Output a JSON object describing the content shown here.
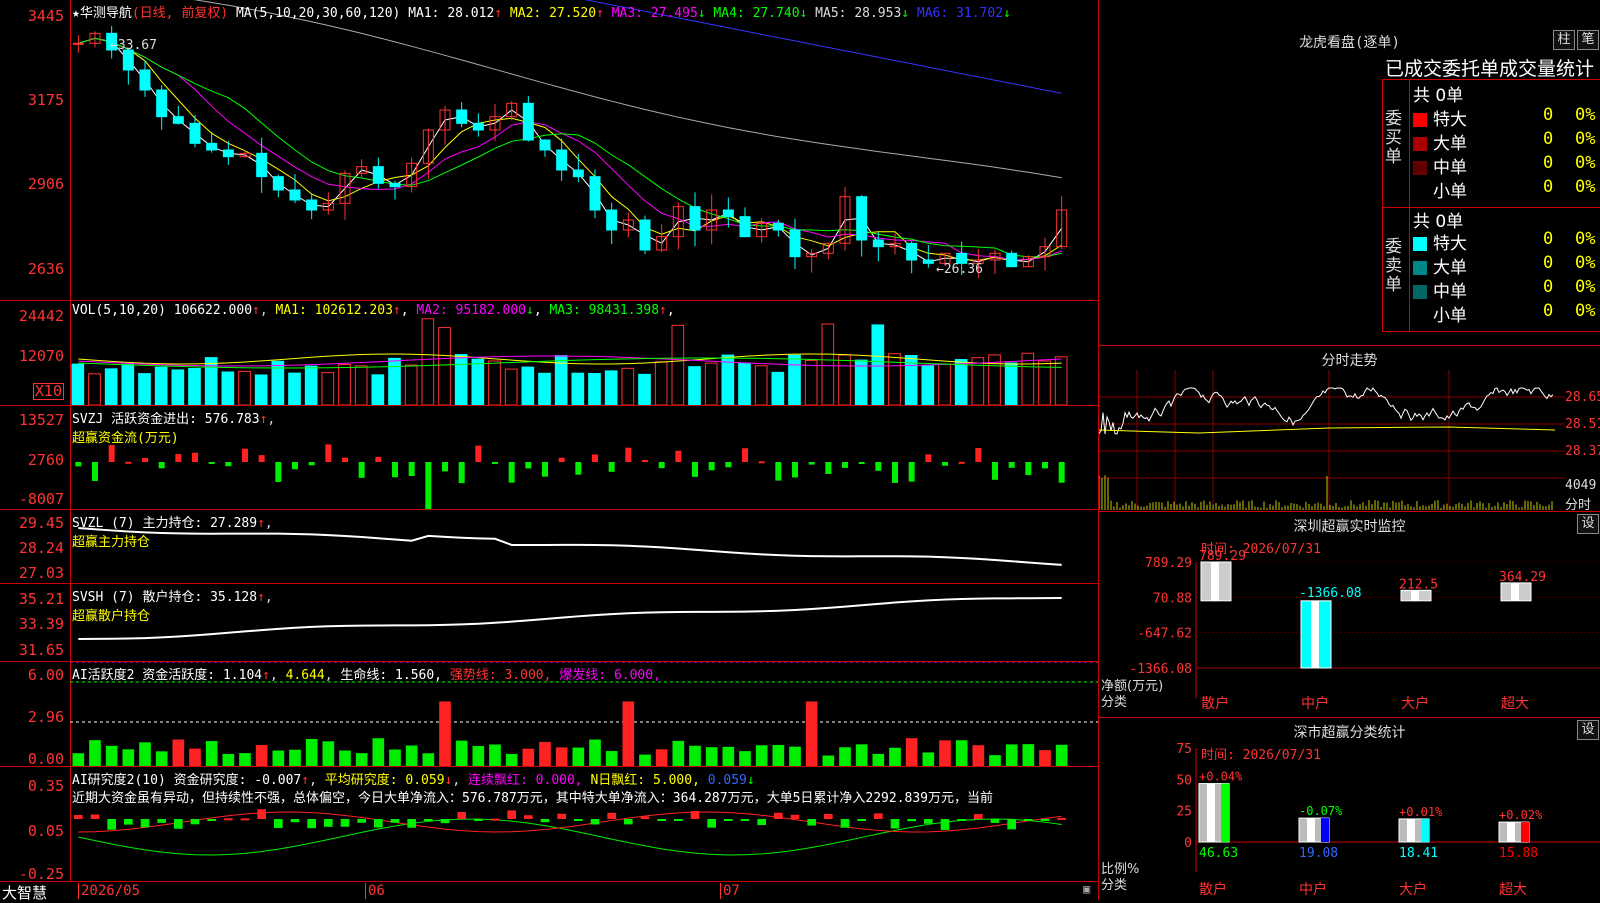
{
  "stock": {
    "name": "华测导航",
    "period": "(日线, 前复权)"
  },
  "kline": {
    "header_ma": "MA(5,10,20,30,60,120)",
    "ma_values": [
      {
        "label": "MA1:",
        "value": "28.012",
        "arrow": "↑",
        "color": "#ffffff"
      },
      {
        "label": "MA2:",
        "value": "27.520",
        "arrow": "↑",
        "color": "#ffff00"
      },
      {
        "label": "MA3:",
        "value": "27.495",
        "arrow": "↓",
        "color": "#ff00ff"
      },
      {
        "label": "MA4:",
        "value": "27.740",
        "arrow": "↓",
        "color": "#00ff00"
      },
      {
        "label": "MA5:",
        "value": "28.953",
        "arrow": "↓",
        "color": "#dddddd"
      },
      {
        "label": "MA6:",
        "value": "31.702",
        "arrow": "↓",
        "color": "#3333ff"
      }
    ],
    "y_labels": [
      "3445",
      "3175",
      "2906",
      "2636"
    ],
    "high_label": "←33.67",
    "low_label": "←26.36"
  },
  "vol": {
    "label": "VOL(5,10,20)",
    "value": "106622.000",
    "arrow": "↑",
    "ma": [
      {
        "label": "MA1:",
        "value": "102612.203",
        "arrow": "↑",
        "color": "#ffff00"
      },
      {
        "label": "MA2:",
        "value": "95182.000",
        "arrow": "↓",
        "color": "#ff00ff"
      },
      {
        "label": "MA3:",
        "value": "98431.398",
        "arrow": "↑",
        "color": "#00ff00"
      }
    ],
    "y_labels": [
      "24442",
      "12070"
    ],
    "unit": "X10"
  },
  "svzj": {
    "label": "SVZJ  活跃资金进出:",
    "value": "576.783",
    "arrow": "↑",
    "sub": "超赢资金流(万元)",
    "y_labels": [
      "13527",
      "2760",
      "-8007"
    ]
  },
  "svzl": {
    "label": "SVZL (7) 主力持仓:",
    "value": "27.289",
    "arrow": "↑",
    "sub": "超赢主力持仓",
    "y_labels": [
      "29.45",
      "28.24",
      "27.03"
    ]
  },
  "svsh": {
    "label": "SVSH (7) 散户持仓:",
    "value": "35.128",
    "arrow": "↑",
    "sub": "超赢散户持仓",
    "y_labels": [
      "35.21",
      "33.39",
      "31.65"
    ]
  },
  "ai1": {
    "label": "AI活跃度2 资金活跃度:",
    "value": "1.104",
    "arrow": "↑",
    "v2": "4.644",
    "life": "生命线: 1.560,",
    "strong": "强势线: 3.000,",
    "burst": "爆发线: 6.000,",
    "y_labels": [
      "6.00",
      "2.96",
      "0.00"
    ]
  },
  "ai2": {
    "label": "AI研究度2(10) 资金研究度:",
    "value": "-0.007",
    "arrow": "↑",
    "avg": "平均研究度: 0.059",
    "cont": "连续飘红: 0.000,",
    "nday": "N日飘红: 5.000,",
    "last": "0.059",
    "text": "近期大资金虽有异动，但持续性不强，总体偏空，今日大单净流入：576.787万元，其中特大单净流入：364.287万元，大单5日累计净入2292.839万元，当前",
    "y_labels": [
      "0.35",
      "0.05",
      "-0.25"
    ]
  },
  "xaxis": {
    "labels": [
      "2026/05",
      "06",
      "07"
    ],
    "brand": "大智慧"
  },
  "lhb": {
    "title": "龙虎看盘(逐单)",
    "btn1": "柱",
    "btn2": "笔",
    "subtitle": "已成交委托单成交量统计",
    "buy": {
      "side": "委买单",
      "total": "共 0单",
      "rows": [
        {
          "name": "特大",
          "val": "0",
          "pct": "0%",
          "color": "#ff0000"
        },
        {
          "name": "大单",
          "val": "0",
          "pct": "0%",
          "color": "#aa0000"
        },
        {
          "name": "中单",
          "val": "0",
          "pct": "0%",
          "color": "#660000"
        },
        {
          "name": "小单",
          "val": "0",
          "pct": "0%",
          "color": "#000000"
        }
      ]
    },
    "sell": {
      "side": "委卖单",
      "total": "共 0单",
      "rows": [
        {
          "name": "特大",
          "val": "0",
          "pct": "0%",
          "color": "#00ffff"
        },
        {
          "name": "大单",
          "val": "0",
          "pct": "0%",
          "color": "#008888"
        },
        {
          "name": "中单",
          "val": "0",
          "pct": "0%",
          "color": "#006666"
        },
        {
          "name": "小单",
          "val": "0",
          "pct": "0%",
          "color": "#000000"
        }
      ]
    }
  },
  "fs": {
    "title": "分时走势",
    "y_labels": [
      "28.65",
      "28.51",
      "28.37"
    ],
    "vol_label": "4049",
    "unit": "分时"
  },
  "sz_monitor": {
    "title": "深圳超赢实时监控",
    "btn": "设",
    "time": "时间: 2026/07/31",
    "y_labels": [
      "789.29",
      "70.88",
      "-647.62",
      "-1366.08"
    ],
    "unit_label": "净额(万元)",
    "cat_label": "分类",
    "bars": [
      {
        "cat": "散户",
        "value": 789.29,
        "label": "789.29"
      },
      {
        "cat": "中户",
        "value": -1366.08,
        "label": "-1366.08"
      },
      {
        "cat": "大户",
        "value": 212.5,
        "label": "212.5"
      },
      {
        "cat": "超大",
        "value": 364.29,
        "label": "364.29"
      }
    ]
  },
  "sz_class": {
    "title": "深市超赢分类统计",
    "btn": "设",
    "time": "时间: 2026/07/31",
    "y_labels": [
      "75",
      "50",
      "25",
      "0"
    ],
    "unit_label": "比例%",
    "cat_label": "分类",
    "bars": [
      {
        "cat": "散户",
        "value": 46.63,
        "pct": "+0.04%",
        "color": "#00ff00",
        "label": "46.63"
      },
      {
        "cat": "中户",
        "value": 19.08,
        "pct": "-0.07%",
        "color": "#0000ff",
        "label": "19.08"
      },
      {
        "cat": "大户",
        "value": 18.41,
        "pct": "+0.01%",
        "color": "#00ffff",
        "label": "18.41"
      },
      {
        "cat": "超大",
        "value": 15.88,
        "pct": "+0.02%",
        "color": "#ff0000",
        "label": "15.88"
      }
    ]
  }
}
